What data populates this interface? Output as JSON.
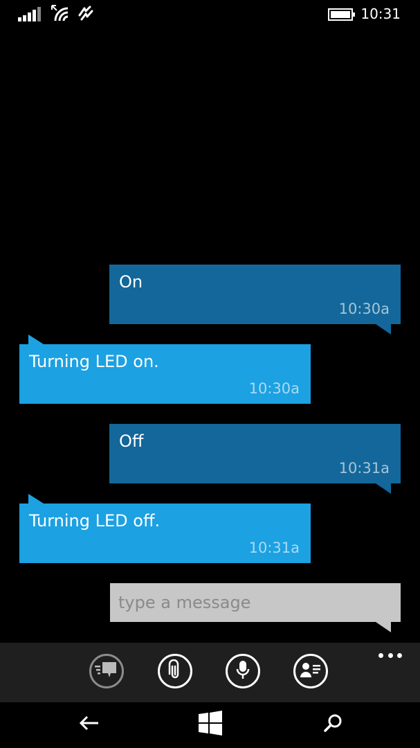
{
  "status_bar": {
    "time": "10:31",
    "icons": [
      "signal-strength-icon",
      "wifi-icon",
      "data-sense-icon",
      "battery-icon"
    ]
  },
  "messages": [
    {
      "direction": "sent",
      "text": "On",
      "time": "10:30a"
    },
    {
      "direction": "received",
      "text": "Turning LED on.",
      "time": "10:30a"
    },
    {
      "direction": "sent",
      "text": "Off",
      "time": "10:31a"
    },
    {
      "direction": "received",
      "text": "Turning LED off.",
      "time": "10:31a"
    }
  ],
  "compose": {
    "placeholder": "type a message",
    "value": ""
  },
  "app_bar": {
    "buttons": [
      "switch-conversation-icon",
      "attach-icon",
      "microphone-icon",
      "contact-card-icon"
    ],
    "more": "more-options-icon"
  },
  "nav_bar": {
    "buttons": [
      "back-icon",
      "windows-start-icon",
      "search-icon"
    ]
  },
  "colors": {
    "sent_bubble": "#13679a",
    "received_bubble": "#1ca1e2",
    "compose_bg": "#c7c7c7",
    "app_bar_bg": "#1f1f1f",
    "background": "#000000"
  }
}
